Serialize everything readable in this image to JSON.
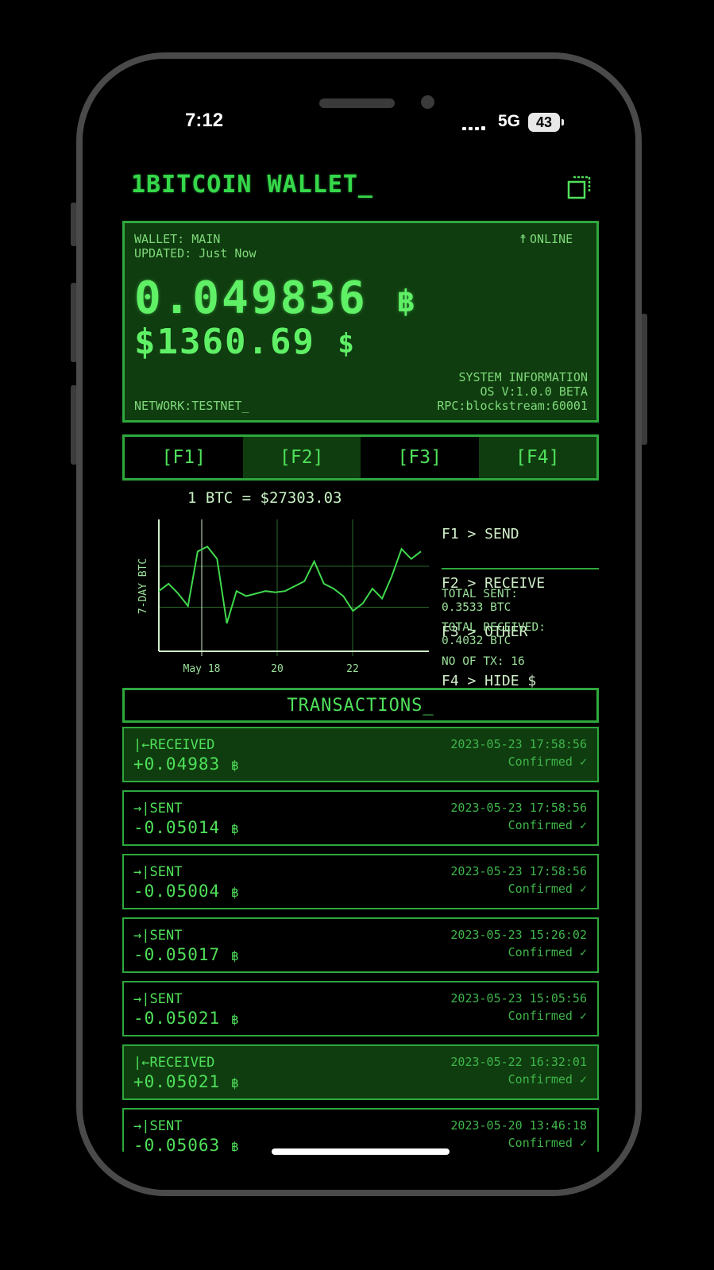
{
  "status_bar": {
    "time": "7:12",
    "network": "5G",
    "battery": "43"
  },
  "app": {
    "title": "1BITCOIN WALLET_"
  },
  "wallet": {
    "name_label": "WALLET: MAIN",
    "updated_label": "UPDATED: Just Now",
    "online": "ONLINE",
    "btc_balance": "0.049836",
    "btc_symbol": "฿",
    "usd_balance": "$1360.69",
    "usd_symbol": "$",
    "network": "NETWORK:TESTNET_",
    "system_info": "SYSTEM INFORMATION",
    "os_version": "OS V:1.0.0 BETA",
    "rpc": "RPC:blockstream:60001"
  },
  "fkeys": [
    "[F1]",
    "[F2]",
    "[F3]",
    "[F4]"
  ],
  "price": {
    "label": "1 BTC = $27303.03"
  },
  "menu": [
    "F1 > SEND",
    "F2 > RECEIVE",
    "F3 > OTHER",
    "F4 > HIDE $"
  ],
  "stats": {
    "total_sent_label": "TOTAL SENT:",
    "total_sent": "0.3533 BTC",
    "total_received_label": "TOTAL RECEIVED:",
    "total_received": "0.4032 BTC",
    "tx_count": "NO OF TX: 16"
  },
  "chart_data": {
    "type": "line",
    "title": "",
    "xlabel": "",
    "ylabel": "7-DAY BTC",
    "x_tick_labels": [
      "May 18",
      "20",
      "22"
    ],
    "x": [
      "May 17 00:00",
      "May 17 06:00",
      "May 17 12:00",
      "May 17 18:00",
      "May 18 00:00",
      "May 18 06:00",
      "May 18 12:00",
      "May 18 18:00",
      "May 19 00:00",
      "May 19 06:00",
      "May 19 12:00",
      "May 19 18:00",
      "May 20 00:00",
      "May 20 06:00",
      "May 20 12:00",
      "May 20 18:00",
      "May 21 00:00",
      "May 21 06:00",
      "May 21 12:00",
      "May 21 18:00",
      "May 22 00:00",
      "May 22 06:00",
      "May 22 12:00",
      "May 22 18:00",
      "May 23 00:00",
      "May 23 06:00",
      "May 23 12:00",
      "May 23 18:00"
    ],
    "y": [
      0.46,
      0.52,
      0.44,
      0.34,
      0.78,
      0.82,
      0.72,
      0.2,
      0.46,
      0.42,
      0.44,
      0.46,
      0.45,
      0.46,
      0.5,
      0.54,
      0.7,
      0.52,
      0.48,
      0.42,
      0.3,
      0.36,
      0.48,
      0.4,
      0.58,
      0.8,
      0.72,
      0.78
    ],
    "grid": true,
    "legend": "none"
  },
  "transactions_title": "TRANSACTIONS_",
  "transactions": [
    {
      "type": "RECEIVED",
      "icon": "|←",
      "amount": "+0.04983",
      "date": "2023-05-23 17:58:56",
      "status": "Confirmed ✓"
    },
    {
      "type": "SENT",
      "icon": "→|",
      "amount": "-0.05014",
      "date": "2023-05-23 17:58:56",
      "status": "Confirmed ✓"
    },
    {
      "type": "SENT",
      "icon": "→|",
      "amount": "-0.05004",
      "date": "2023-05-23 17:58:56",
      "status": "Confirmed ✓"
    },
    {
      "type": "SENT",
      "icon": "→|",
      "amount": "-0.05017",
      "date": "2023-05-23 15:26:02",
      "status": "Confirmed ✓"
    },
    {
      "type": "SENT",
      "icon": "→|",
      "amount": "-0.05021",
      "date": "2023-05-23 15:05:56",
      "status": "Confirmed ✓"
    },
    {
      "type": "RECEIVED",
      "icon": "|←",
      "amount": "+0.05021",
      "date": "2023-05-22 16:32:01",
      "status": "Confirmed ✓"
    },
    {
      "type": "SENT",
      "icon": "→|",
      "amount": "-0.05063",
      "date": "2023-05-20 13:46:18",
      "status": "Confirmed ✓"
    }
  ],
  "colors": {
    "accent": "#4fe05a",
    "panel": "#0f3d0f",
    "border": "#2ea83d",
    "background": "#000000"
  }
}
